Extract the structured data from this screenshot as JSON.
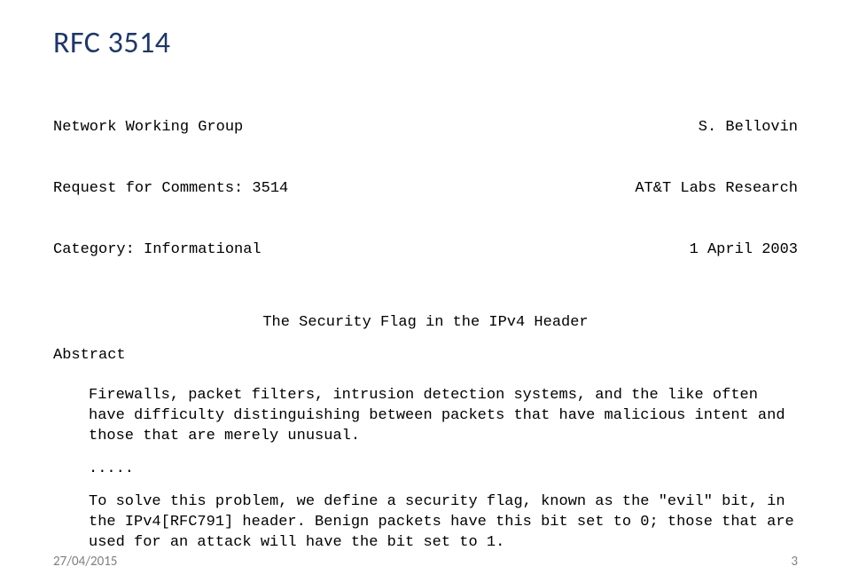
{
  "title": "RFC 3514",
  "header": {
    "rows": [
      {
        "left": "Network Working Group",
        "right": "S. Bellovin"
      },
      {
        "left": "Request for Comments: 3514",
        "right": "AT&T Labs Research"
      },
      {
        "left": "Category: Informational",
        "right": "1 April 2003"
      }
    ],
    "subtitle": "The Security Flag in the IPv4 Header",
    "abstract_label": "Abstract"
  },
  "body": {
    "para1": "Firewalls, packet filters, intrusion detection systems, and the like often have difficulty distinguishing between packets that have malicious intent and those that are merely unusual.",
    "ellipsis": ".....",
    "para2": "To solve this problem, we define a security flag, known as the \"evil\" bit, in the IPv4[RFC791] header. Benign packets have this bit set to 0; those that are used for an attack will have the bit set to 1."
  },
  "footer": {
    "date": "27/04/2015",
    "page": "3"
  }
}
